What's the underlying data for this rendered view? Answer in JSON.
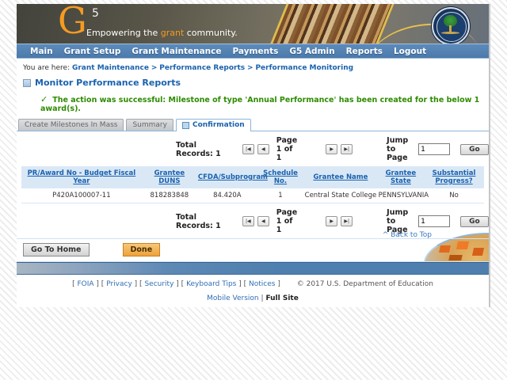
{
  "header": {
    "logo_g": "G",
    "logo_sup": "5",
    "tagline_pre": "Empowering the ",
    "tagline_highlight": "grant",
    "tagline_post": " community."
  },
  "nav": {
    "items": [
      "Main",
      "Grant Setup",
      "Grant Maintenance",
      "Payments",
      "G5 Admin",
      "Reports",
      "Logout"
    ]
  },
  "breadcrumb": {
    "prefix": "You are here:",
    "separator": ">",
    "items": [
      "Grant Maintenance",
      "Performance Reports",
      "Performance Monitoring"
    ]
  },
  "page": {
    "title": "Monitor Performance Reports",
    "check": "✓",
    "success_message": "The action was successful: Milestone of type 'Annual Performance' has been created for the below 1 award(s)."
  },
  "tabs": {
    "create_mass": "Create Milestones In Mass",
    "summary": "Summary",
    "confirmation": "Confirmation"
  },
  "pagination": {
    "total_label": "Total Records:",
    "total_value": "1",
    "first": "|◀",
    "prev": "◀",
    "next": "▶",
    "last": "▶|",
    "page_label": "Page 1 of 1",
    "jump_label": "Jump to Page",
    "jump_value": "1",
    "go_label": "Go"
  },
  "table": {
    "headers": [
      "PR/Award No - Budget Fiscal Year",
      "Grantee DUNS",
      "CFDA/Subprogram",
      "Schedule No.",
      "Grantee Name",
      "Grantee State",
      "Substantial Progress?"
    ],
    "rows": [
      [
        "P420A100007-11",
        "818283848",
        "84.420A",
        "1",
        "Central State College",
        "PENNSYLVANIA",
        "No"
      ]
    ]
  },
  "actions": {
    "go_home": "Go To Home",
    "done": "Done"
  },
  "back_to_top": {
    "caret": "^",
    "label": "Back to Top"
  },
  "footer": {
    "bracket_open": "[",
    "bracket_close": "]",
    "links": [
      "FOIA",
      "Privacy",
      "Security",
      "Keyboard Tips",
      "Notices"
    ],
    "copyright": "©  2017  U.S.  Department  of  Education",
    "mobile_version": "Mobile Version",
    "divider": "|",
    "full_site": "Full Site"
  },
  "colors": {
    "nav_blue": "#4b7aab",
    "link_blue": "#1a62ae",
    "success_green": "#2e8b00",
    "done_orange": "#eda23c",
    "logo_orange": "#f59b22"
  }
}
